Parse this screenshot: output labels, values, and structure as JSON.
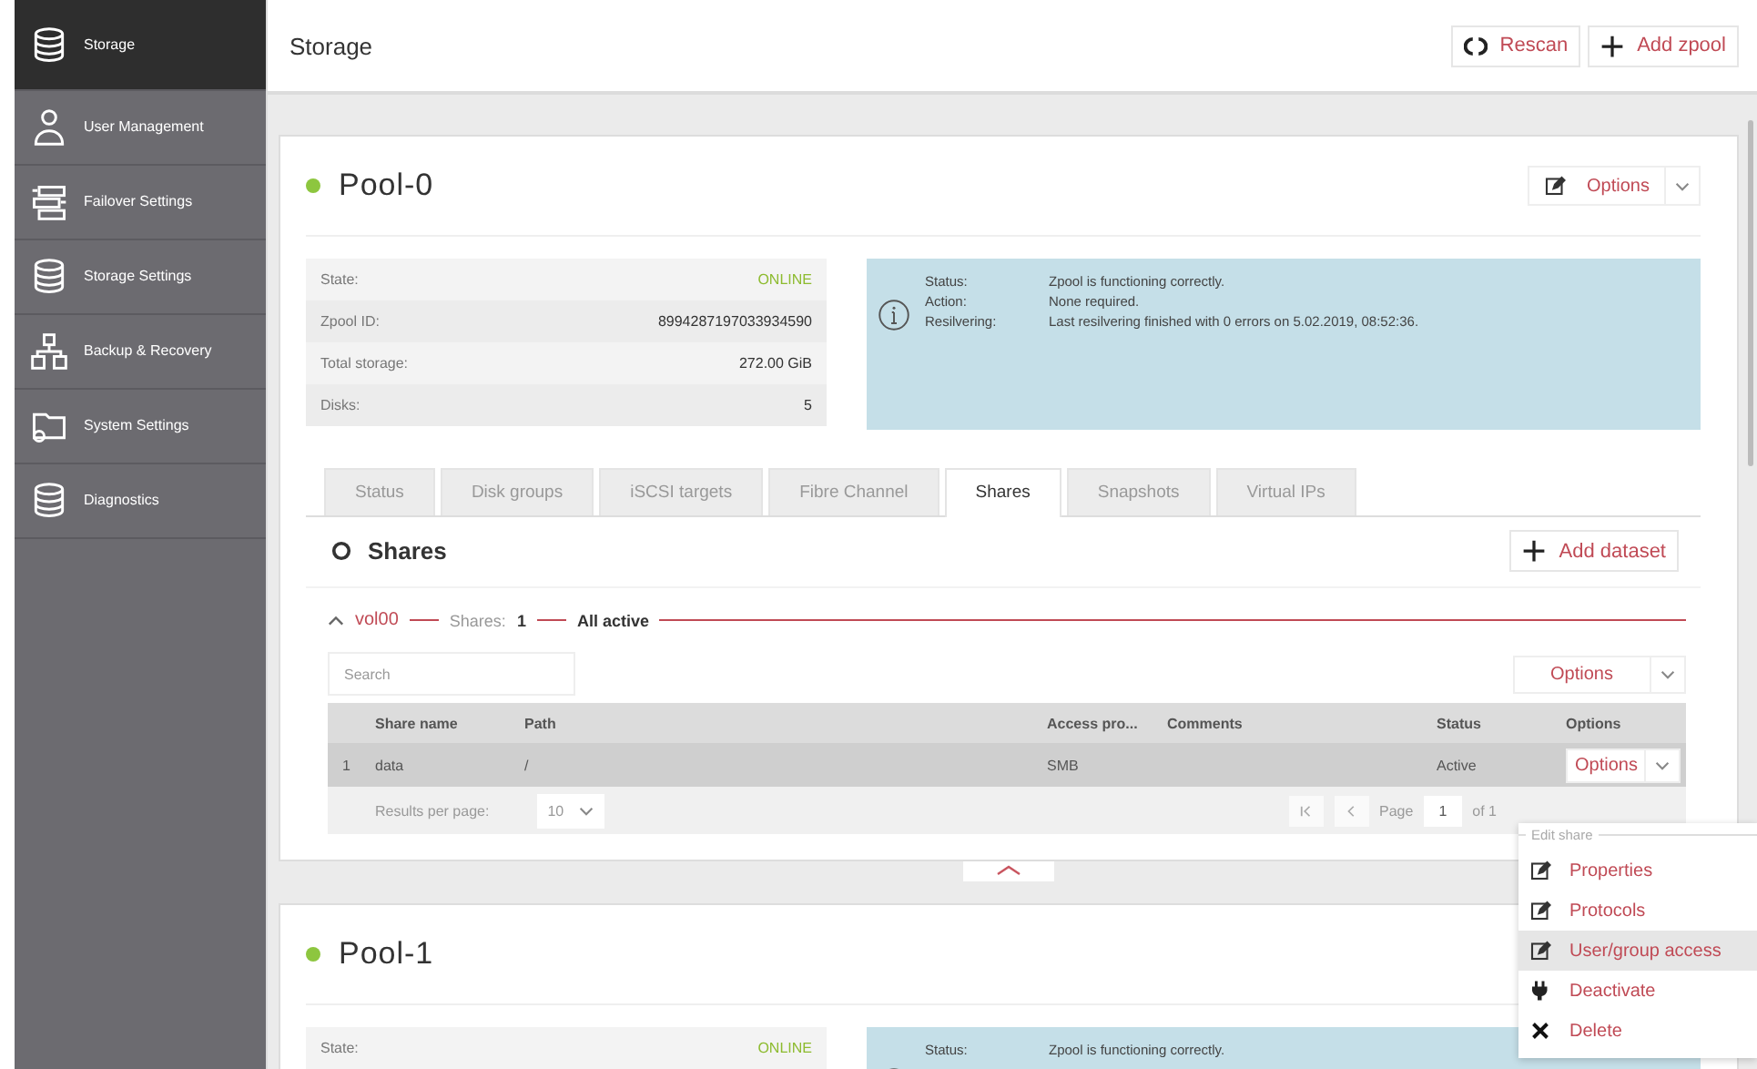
{
  "sidebar": {
    "items": [
      {
        "label": "Storage",
        "kind": "storage",
        "selected": true
      },
      {
        "label": "User Management",
        "kind": "users",
        "selected": false
      },
      {
        "label": "Failover Settings",
        "kind": "failover",
        "selected": false
      },
      {
        "label": "Storage Settings",
        "kind": "storage-settings",
        "selected": false
      },
      {
        "label": "Backup & Recovery",
        "kind": "backup",
        "selected": false
      },
      {
        "label": "System Settings",
        "kind": "system",
        "selected": false
      },
      {
        "label": "Diagnostics",
        "kind": "diagnostics",
        "selected": false
      }
    ]
  },
  "header": {
    "title": "Storage",
    "buttons": [
      {
        "label": "Rescan",
        "kind": "rescan"
      },
      {
        "label": "Add zpool",
        "kind": "add"
      }
    ]
  },
  "pools": [
    {
      "name": "Pool-0",
      "options_label": "Options",
      "properties": [
        {
          "label": "State:",
          "value": "ONLINE",
          "kind": "state"
        },
        {
          "label": "Zpool ID:",
          "value": "8994287197033934590",
          "kind": "value"
        },
        {
          "label": "Total storage:",
          "value": "272.00 GiB",
          "kind": "value"
        },
        {
          "label": "Disks:",
          "value": "5",
          "kind": "value"
        }
      ],
      "info": [
        {
          "label": "Status:",
          "value": "Zpool is functioning correctly."
        },
        {
          "label": "Action:",
          "value": "None required."
        },
        {
          "label": "Resilvering:",
          "value": "Last resilvering finished with 0 errors on 5.02.2019, 08:52:36."
        }
      ],
      "tabs": [
        {
          "label": "Status",
          "selected": false
        },
        {
          "label": "Disk groups",
          "selected": false
        },
        {
          "label": "iSCSI targets",
          "selected": false
        },
        {
          "label": "Fibre Channel",
          "selected": false
        },
        {
          "label": "Shares",
          "selected": true
        },
        {
          "label": "Snapshots",
          "selected": false
        },
        {
          "label": "Virtual IPs",
          "selected": false
        }
      ],
      "shares": {
        "title": "Shares",
        "add_button": "Add dataset",
        "dataset": {
          "name": "vol00",
          "expanded": true,
          "shares_label": "Shares:",
          "shares_count": "1",
          "state": "All active",
          "search_placeholder": "Search",
          "options_label": "Options",
          "columns": [
            "Share name",
            "Path",
            "Access pro...",
            "Comments",
            "Status",
            "Options"
          ],
          "rows": [
            {
              "number": "1",
              "share_name": "data",
              "path": "/",
              "access_protocol": "SMB",
              "status": "Active",
              "options": "Options"
            }
          ],
          "footer": {
            "results_label": "Results per page:",
            "per_page": "10",
            "page_label": "Page",
            "page": "1",
            "of": "of 1"
          }
        }
      }
    },
    {
      "name": "Pool-1",
      "properties": [
        {
          "label": "State:",
          "value": "ONLINE",
          "kind": "state"
        }
      ],
      "info": [
        {
          "label": "Status:",
          "value": "Zpool is functioning correctly."
        }
      ]
    }
  ],
  "menu": {
    "header": "Edit share",
    "items": [
      {
        "label": "Properties",
        "kind": "edit",
        "selected": false
      },
      {
        "label": "Protocols",
        "kind": "edit",
        "selected": false
      },
      {
        "label": "User/group access",
        "kind": "edit",
        "selected": true
      },
      {
        "label": "Deactivate",
        "kind": "deactivate",
        "selected": false
      },
      {
        "label": "Delete",
        "kind": "delete",
        "selected": false
      }
    ]
  }
}
